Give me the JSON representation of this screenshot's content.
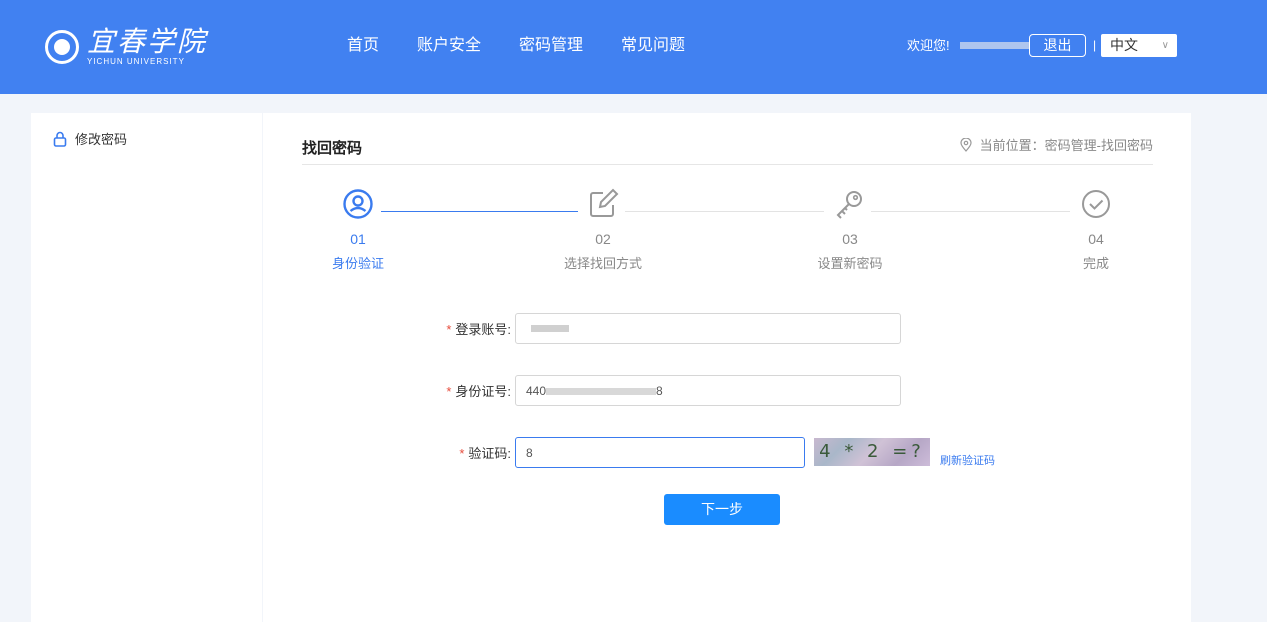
{
  "header": {
    "logo_text": "宜春学院",
    "logo_subtext": "YICHUN UNIVERSITY",
    "nav": [
      "首页",
      "账户安全",
      "密码管理",
      "常见问题"
    ],
    "welcome": "欢迎您!",
    "logout_label": "退出",
    "separator": "|",
    "language": "中文"
  },
  "sidebar": {
    "items": [
      {
        "label": "修改密码",
        "icon": "lock-icon"
      }
    ]
  },
  "main": {
    "title": "找回密码",
    "breadcrumb": "当前位置：密码管理-找回密码",
    "steps": [
      {
        "num": "01",
        "label": "身份验证",
        "icon": "user-circle-icon",
        "state": "active"
      },
      {
        "num": "02",
        "label": "选择找回方式",
        "icon": "edit-icon",
        "state": "inactive"
      },
      {
        "num": "03",
        "label": "设置新密码",
        "icon": "key-icon",
        "state": "inactive"
      },
      {
        "num": "04",
        "label": "完成",
        "icon": "check-circle-icon",
        "state": "inactive"
      }
    ],
    "form": {
      "account_label": "登录账号:",
      "idcard_label": "身份证号:",
      "idcard_value_prefix": "440",
      "idcard_value_suffix": "8",
      "captcha_label": "验证码:",
      "captcha_value": "8",
      "captcha_image_text": "4 * 2 =?",
      "refresh_label": "刷新验证码",
      "next_label": "下一步"
    }
  },
  "colors": {
    "header": "#4181f1",
    "accent": "#3a7bef",
    "button": "#1a8cff",
    "required": "#e74c3c"
  }
}
